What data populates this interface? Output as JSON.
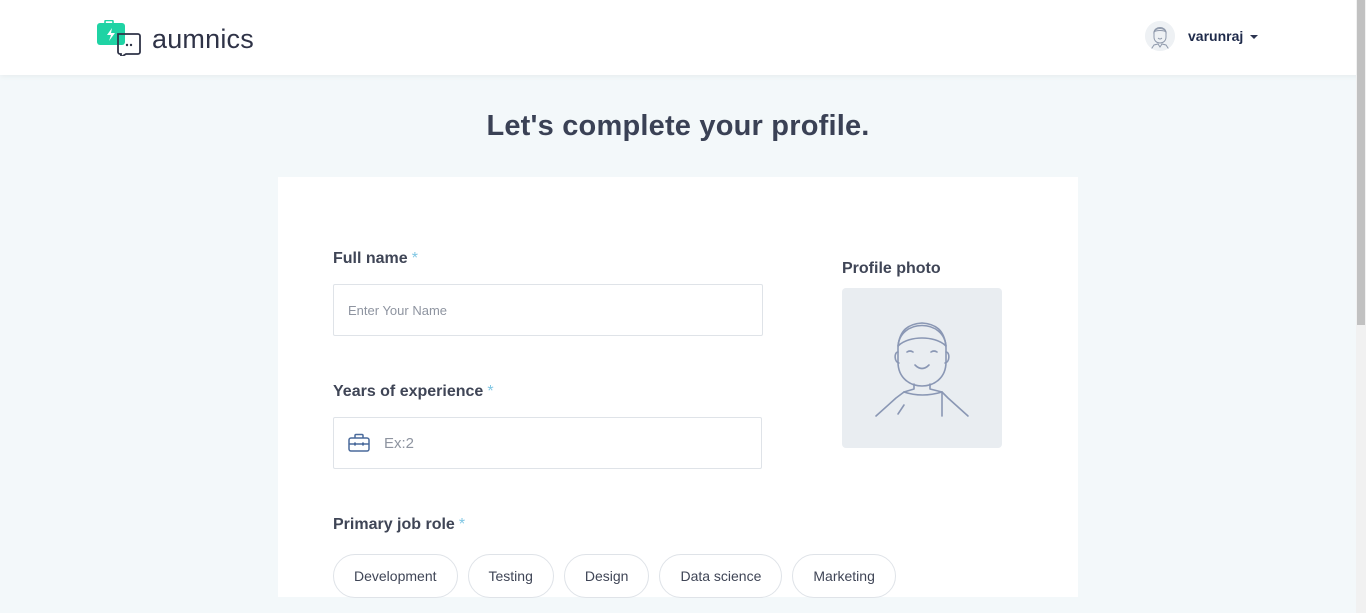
{
  "app": {
    "brand": "aumnics",
    "colors": {
      "brand_green": "#1fd3a4",
      "accent_blue": "#7fc6e3",
      "text_dark": "#3a4155"
    }
  },
  "header": {
    "username": "varunraj",
    "user_menu_icon": "caret-down-icon",
    "avatar_icon": "user-avatar-icon"
  },
  "main": {
    "title": "Let's complete your profile.",
    "form": {
      "full_name": {
        "label": "Full name",
        "required_mark": "*",
        "placeholder": "Enter Your Name",
        "value": ""
      },
      "experience": {
        "label": "Years of experience",
        "required_mark": "*",
        "placeholder": "Ex:2",
        "value": "",
        "icon": "briefcase-icon"
      },
      "profile_photo": {
        "label": "Profile photo",
        "icon": "person-placeholder-icon"
      },
      "job_role": {
        "label": "Primary job role",
        "required_mark": "*",
        "options": [
          "Development",
          "Testing",
          "Design",
          "Data science",
          "Marketing"
        ]
      }
    }
  }
}
